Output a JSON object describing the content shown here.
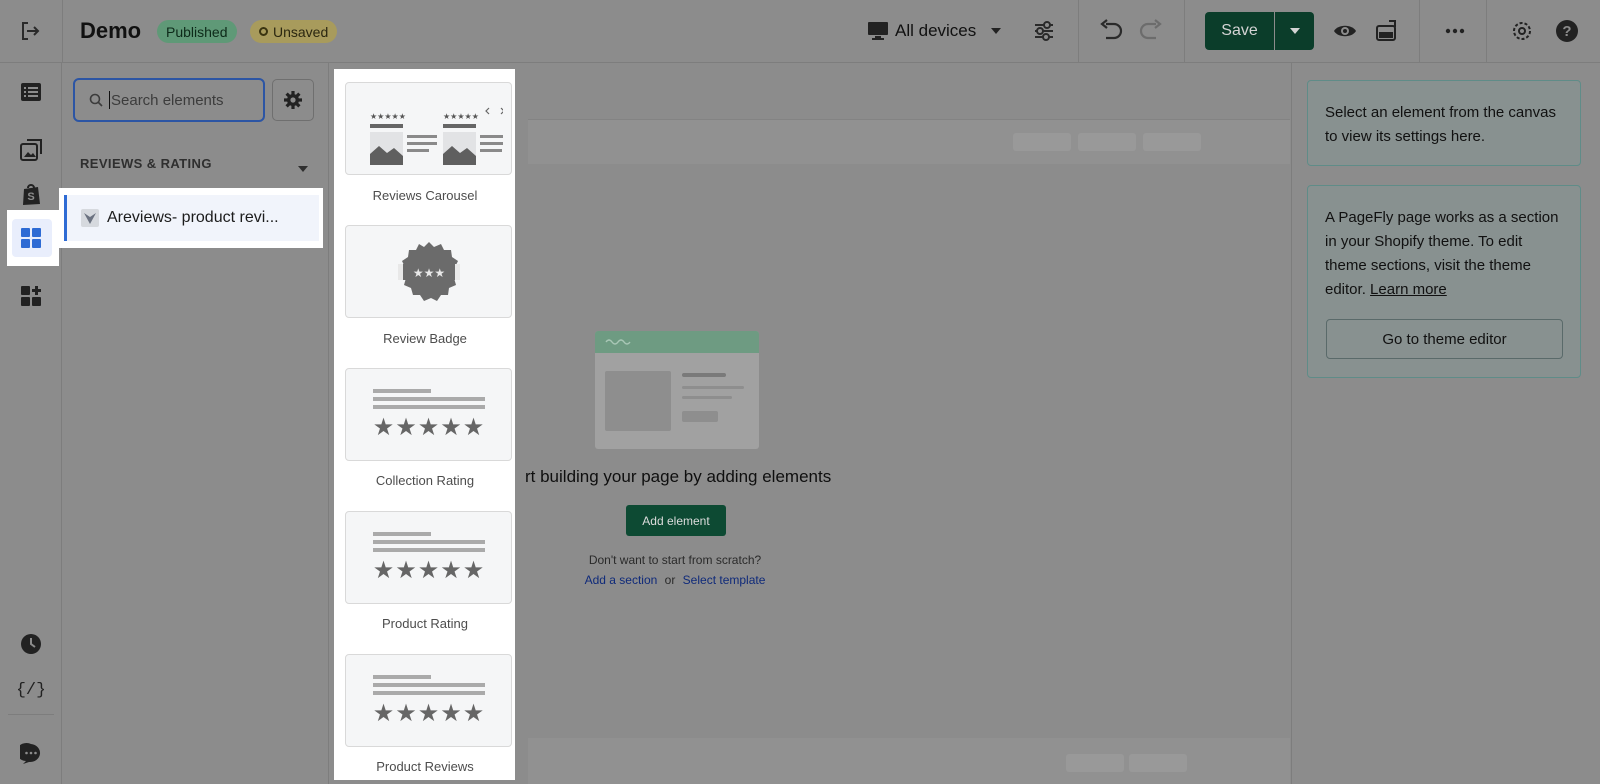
{
  "header": {
    "title": "Demo",
    "published_badge": "Published",
    "unsaved_badge": "Unsaved",
    "devices_label": "All devices",
    "save_label": "Save"
  },
  "sidebar": {
    "search_placeholder": "Search elements",
    "section_title": "REVIEWS & RATING",
    "items": [
      {
        "label": "Areviews- product revi..."
      }
    ]
  },
  "gallery": {
    "tiles": [
      {
        "label": "Reviews Carousel",
        "icon": "reviews-carousel-icon"
      },
      {
        "label": "Review Badge",
        "icon": "review-badge-icon"
      },
      {
        "label": "Collection Rating",
        "icon": "collection-rating-icon"
      },
      {
        "label": "Product Rating",
        "icon": "product-rating-icon"
      },
      {
        "label": "Product Reviews",
        "icon": "product-reviews-icon"
      }
    ]
  },
  "canvas": {
    "empty_title": "rt building your page by adding elements",
    "add_element_label": "Add element",
    "no_scratch_text": "Don't want to start from scratch?",
    "add_section_link": "Add a section",
    "or_text": "or",
    "select_template_link": "Select template"
  },
  "right_panel": {
    "info_text": "Select an element from the canvas to view its settings here.",
    "pagefly_text": "A PageFly page works as a section in your Shopify theme. To edit theme sections, visit the theme editor.",
    "learn_more": "Learn more",
    "theme_editor_button": "Go to theme editor"
  },
  "colors": {
    "accent_blue": "#2e6bd4",
    "save_green": "#0b3d2a",
    "published_green": "#5f9977",
    "unsaved_yellow": "#a89b5c"
  }
}
